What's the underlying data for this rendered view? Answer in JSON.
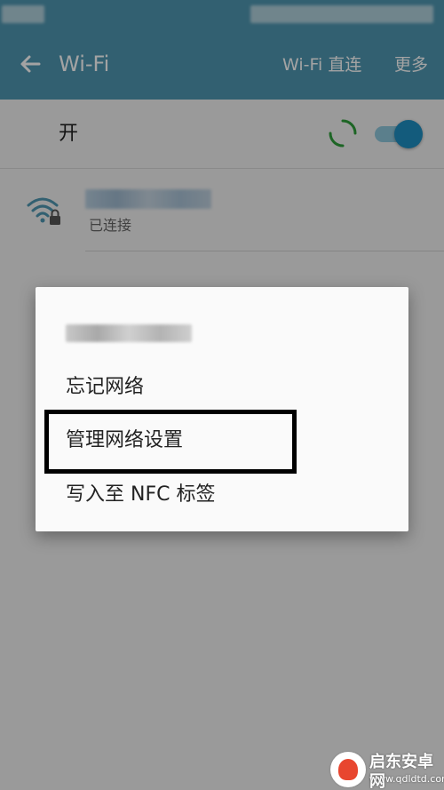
{
  "header": {
    "title": "Wi-Fi",
    "wifi_direct_label": "Wi-Fi 直连",
    "more_label": "更多"
  },
  "wifi_toggle": {
    "label": "开",
    "state": "on",
    "accent_color": "#1f8fc2"
  },
  "network": {
    "status": "已连接"
  },
  "dialog": {
    "items": [
      {
        "label": "忘记网络"
      },
      {
        "label": "管理网络设置"
      },
      {
        "label": "写入至 NFC 标签"
      }
    ]
  },
  "watermark": {
    "name": "启东安卓网",
    "url": "www.qdldtd.com"
  },
  "colors": {
    "toolbar": "#4f97b1",
    "background": "#f1f1f1",
    "spinner": "#2e9e3a"
  }
}
